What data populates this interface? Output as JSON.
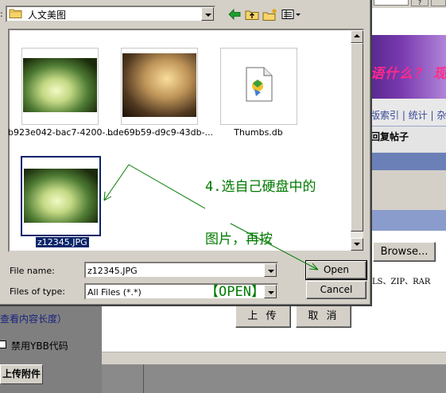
{
  "background_page": {
    "banner_text": "语什么？ 现",
    "nav_text": "版索引 | 统计 | 杂",
    "reply_text": "回复帖子",
    "browse_label": "Browse...",
    "zip_note": "LS、ZIP、RAR",
    "upload_button": "上 传",
    "cancel_button": "取 消",
    "view_length_link": "查看内容长度）",
    "disable_ybb_label": "禁用YBB代码",
    "upload_attachment_button": "上传附件",
    "top_button": "?"
  },
  "dialog": {
    "look_in": {
      "label_fragment": ":",
      "value": "人文美图",
      "icon": "folder-icon"
    },
    "toolbar": [
      {
        "name": "back-icon",
        "icon": "green-left-arrow"
      },
      {
        "name": "up-folder-icon",
        "icon": "folder-up"
      },
      {
        "name": "new-folder-icon",
        "icon": "new-folder"
      },
      {
        "name": "view-menu-icon",
        "icon": "view-list"
      }
    ],
    "files": [
      {
        "label": "b923e042-bac7-4200-...",
        "kind": "photo-forest",
        "selected": false
      },
      {
        "label": "bde69b59-d9c9-43db-...",
        "kind": "photo-sepia",
        "selected": false
      },
      {
        "label": "Thumbs.db",
        "kind": "db-file",
        "selected": false
      },
      {
        "label": "z12345.JPG",
        "kind": "photo-forest",
        "selected": true
      }
    ],
    "file_name": {
      "label": "File name:",
      "value": "z12345.JPG"
    },
    "files_of_type": {
      "label": "Files of type:",
      "value": "All Files (*.*)"
    },
    "open_button": "Open",
    "cancel_button": "Cancel"
  },
  "annotation": {
    "lines": [
      "4.选自己硬盘中的",
      "图片，再按",
      "【OPEN】"
    ],
    "color": "#007a00"
  }
}
